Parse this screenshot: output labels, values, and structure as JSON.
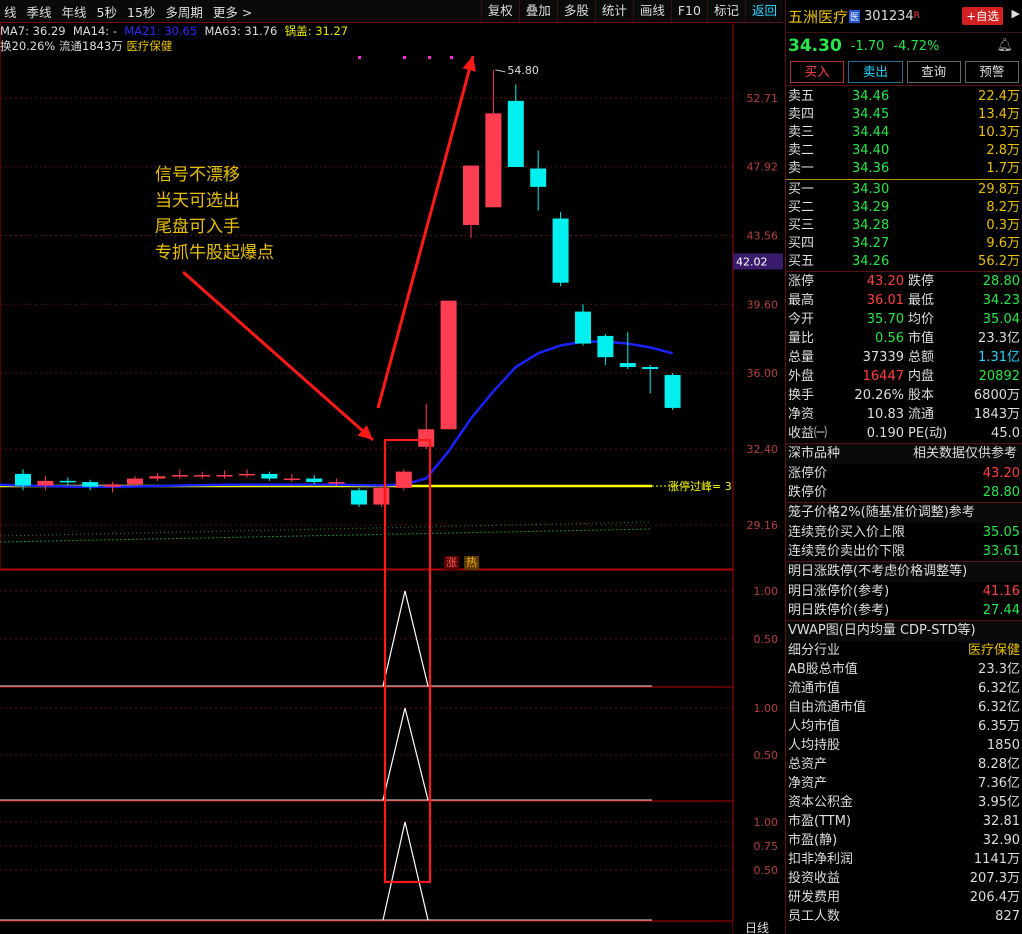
{
  "toolbar": {
    "left": [
      "线",
      "季线",
      "年线",
      "5秒",
      "15秒",
      "多周期",
      "更多 >"
    ],
    "right": [
      "复权",
      "叠加",
      "多股",
      "统计",
      "画线",
      "F10",
      "标记",
      "返回"
    ],
    "active": "返回"
  },
  "ma": {
    "ma7": "MA7: 36.29",
    "ma14": "MA14: -",
    "ma21": "MA21: 30.65",
    "ma63": "MA63: 31.76",
    "gai": "锅盖: 31.27"
  },
  "info": {
    "text": "换20.26% 流通1843万",
    "industry": "医疗保健"
  },
  "price_axis": [
    "52.71",
    "47.92",
    "43.56",
    "39.60",
    "36.00",
    "32.40",
    "29.16"
  ],
  "current_price_tag": "42.02",
  "high_label": "54.80",
  "limit_line_label": "涨停过峰= 3",
  "candle_tags": {
    "up": "涨",
    "hot": "热"
  },
  "annotation": [
    "信号不漂移",
    "当天可选出",
    "尾盘可入手",
    "专抓牛股起爆点"
  ],
  "sub_axes": [
    [
      "1.00",
      "0.50"
    ],
    [
      "1.00",
      "0.50"
    ],
    [
      "1.00",
      "0.75",
      "0.50"
    ]
  ],
  "bottom_tag": "日线",
  "stock": {
    "name": "五洲医疗",
    "code": "301234",
    "r": "R",
    "add_btn": "+自选",
    "arrow": "▶",
    "badge": "医"
  },
  "quote": {
    "price": "34.30",
    "change": "-1.70",
    "pct": "-4.72%"
  },
  "actions": [
    "买入",
    "卖出",
    "查询",
    "预警"
  ],
  "asks": [
    {
      "label": "卖五",
      "price": "34.46",
      "vol": "22.4万"
    },
    {
      "label": "卖四",
      "price": "34.45",
      "vol": "13.4万"
    },
    {
      "label": "卖三",
      "price": "34.44",
      "vol": "10.3万"
    },
    {
      "label": "卖二",
      "price": "34.40",
      "vol": "2.8万"
    },
    {
      "label": "卖一",
      "price": "34.36",
      "vol": "1.7万"
    }
  ],
  "bids": [
    {
      "label": "买一",
      "price": "34.30",
      "vol": "29.8万"
    },
    {
      "label": "买二",
      "price": "34.29",
      "vol": "8.2万"
    },
    {
      "label": "买三",
      "price": "34.28",
      "vol": "0.3万"
    },
    {
      "label": "买四",
      "price": "34.27",
      "vol": "9.6万"
    },
    {
      "label": "买五",
      "price": "34.26",
      "vol": "56.2万"
    }
  ],
  "stats": [
    {
      "l1": "涨停",
      "v1": "43.20",
      "c1": "red",
      "l2": "跌停",
      "v2": "28.80",
      "c2": "grn"
    },
    {
      "l1": "最高",
      "v1": "36.01",
      "c1": "red",
      "l2": "最低",
      "v2": "34.23",
      "c2": "grn"
    },
    {
      "l1": "今开",
      "v1": "35.70",
      "c1": "grn",
      "l2": "均价",
      "v2": "35.04",
      "c2": "grn"
    },
    {
      "l1": "量比",
      "v1": "0.56",
      "c1": "grn",
      "l2": "市值",
      "v2": "23.3亿",
      "c2": "wht"
    },
    {
      "l1": "总量",
      "v1": "37339",
      "c1": "wht",
      "l2": "总额",
      "v2": "1.31亿",
      "c2": "cyn"
    },
    {
      "l1": "外盘",
      "v1": "16447",
      "c1": "red",
      "l2": "内盘",
      "v2": "20892",
      "c2": "grn"
    },
    {
      "l1": "换手",
      "v1": "20.26%",
      "c1": "wht",
      "l2": "股本",
      "v2": "6800万",
      "c2": "wht"
    },
    {
      "l1": "净资",
      "v1": "10.83",
      "c1": "wht",
      "l2": "流通",
      "v2": "1843万",
      "c2": "wht"
    },
    {
      "l1": "收益㈠",
      "v1": "0.190",
      "c1": "wht",
      "l2": "PE(动)",
      "v2": "45.0",
      "c2": "wht"
    }
  ],
  "sec1": {
    "title": "深市品种",
    "right": "相关数据仅供参考"
  },
  "limits": [
    {
      "k": "涨停价",
      "v": "43.20",
      "c": "red"
    },
    {
      "k": "跌停价",
      "v": "28.80",
      "c": "grn"
    }
  ],
  "cage": {
    "title": "笼子价格2%(随基准价调整)参考"
  },
  "cage_rows": [
    {
      "k": "连续竞价买入价上限",
      "v": "35.05",
      "c": "grn"
    },
    {
      "k": "连续竞价卖出价下限",
      "v": "33.61",
      "c": "grn"
    }
  ],
  "tomorrow": {
    "title": "明日涨跌停(不考虑价格调整等)"
  },
  "tomorrow_rows": [
    {
      "k": "明日涨停价(参考)",
      "v": "41.16",
      "c": "red"
    },
    {
      "k": "明日跌停价(参考)",
      "v": "27.44",
      "c": "grn"
    }
  ],
  "vwap": {
    "title": "VWAP图(日内均量 CDP-STD等)"
  },
  "fund": [
    {
      "k": "细分行业",
      "v": "医疗保健",
      "c": "yel"
    },
    {
      "k": "AB股总市值",
      "v": "23.3亿",
      "c": "wht"
    },
    {
      "k": "流通市值",
      "v": "6.32亿",
      "c": "wht"
    },
    {
      "k": "自由流通市值",
      "v": "6.32亿",
      "c": "wht"
    },
    {
      "k": "人均市值",
      "v": "6.35万",
      "c": "wht"
    },
    {
      "k": "人均持股",
      "v": "1850",
      "c": "wht"
    },
    {
      "k": "总资产",
      "v": "8.28亿",
      "c": "wht"
    },
    {
      "k": "净资产",
      "v": "7.36亿",
      "c": "wht"
    },
    {
      "k": "资本公积金",
      "v": "3.95亿",
      "c": "wht"
    },
    {
      "k": "市盈(TTM)",
      "v": "32.81",
      "c": "wht"
    },
    {
      "k": "市盈(静)",
      "v": "32.90",
      "c": "wht"
    },
    {
      "k": "扣非净利润",
      "v": "1141万",
      "c": "wht"
    },
    {
      "k": "投资收益",
      "v": "207.3万",
      "c": "wht"
    },
    {
      "k": "研发费用",
      "v": "206.4万",
      "c": "wht"
    },
    {
      "k": "员工人数",
      "v": "827",
      "c": "wht"
    }
  ],
  "candles": [
    {
      "o": 31.3,
      "c": 30.8,
      "h": 31.5,
      "l": 30.6
    },
    {
      "o": 30.8,
      "c": 31.0,
      "h": 31.2,
      "l": 30.6
    },
    {
      "o": 31.0,
      "c": 30.95,
      "h": 31.15,
      "l": 30.8
    },
    {
      "o": 30.95,
      "c": 30.75,
      "h": 31.05,
      "l": 30.6
    },
    {
      "o": 30.75,
      "c": 30.85,
      "h": 30.95,
      "l": 30.5
    },
    {
      "o": 30.85,
      "c": 31.1,
      "h": 31.2,
      "l": 30.8
    },
    {
      "o": 31.1,
      "c": 31.2,
      "h": 31.35,
      "l": 31.0
    },
    {
      "o": 31.2,
      "c": 31.25,
      "h": 31.5,
      "l": 31.1
    },
    {
      "o": 31.25,
      "c": 31.25,
      "h": 31.4,
      "l": 31.1
    },
    {
      "o": 31.25,
      "c": 31.25,
      "h": 31.45,
      "l": 31.1
    },
    {
      "o": 31.25,
      "c": 31.3,
      "h": 31.5,
      "l": 31.15
    },
    {
      "o": 31.3,
      "c": 31.1,
      "h": 31.4,
      "l": 31.0
    },
    {
      "o": 31.1,
      "c": 31.1,
      "h": 31.3,
      "l": 30.95
    },
    {
      "o": 31.1,
      "c": 30.95,
      "h": 31.25,
      "l": 30.85
    },
    {
      "o": 30.95,
      "c": 30.95,
      "h": 31.1,
      "l": 30.8
    },
    {
      "o": 30.6,
      "c": 30.0,
      "h": 30.7,
      "l": 29.9
    },
    {
      "o": 30.0,
      "c": 30.7,
      "h": 30.8,
      "l": 29.9
    },
    {
      "o": 30.7,
      "c": 31.4,
      "h": 31.5,
      "l": 30.6
    },
    {
      "o": 32.5,
      "c": 33.3,
      "h": 34.5,
      "l": 32.4
    },
    {
      "o": 33.3,
      "c": 39.8,
      "h": 39.8,
      "l": 33.3
    },
    {
      "o": 44.2,
      "c": 48.0,
      "h": 48.0,
      "l": 43.4
    },
    {
      "o": 45.3,
      "c": 51.6,
      "h": 54.8,
      "l": 45.3
    },
    {
      "o": 52.5,
      "c": 47.9,
      "h": 53.7,
      "l": 47.9
    },
    {
      "o": 47.8,
      "c": 46.6,
      "h": 49.0,
      "l": 45.1
    },
    {
      "o": 44.6,
      "c": 40.8,
      "h": 45.0,
      "l": 40.6
    },
    {
      "o": 39.2,
      "c": 37.5,
      "h": 39.6,
      "l": 37.4
    },
    {
      "o": 37.9,
      "c": 36.8,
      "h": 38.0,
      "l": 36.4
    },
    {
      "o": 36.5,
      "c": 36.3,
      "h": 38.1,
      "l": 36.2
    },
    {
      "o": 36.3,
      "c": 36.2,
      "h": 36.4,
      "l": 35.0
    },
    {
      "o": 35.9,
      "c": 34.3,
      "h": 36.0,
      "l": 34.2
    }
  ],
  "ma21_series": [
    30.8,
    30.78,
    30.76,
    30.75,
    30.75,
    30.76,
    30.78,
    30.8,
    30.82,
    30.83,
    30.84,
    30.84,
    30.84,
    30.84,
    30.84,
    30.82,
    30.8,
    30.85,
    31.1,
    32.3,
    33.8,
    35.1,
    36.3,
    37.0,
    37.4,
    37.6,
    37.6,
    37.5,
    37.3,
    37.0
  ],
  "colors": {
    "up": "#ff3d50",
    "down": "#00f0f0",
    "ma": "#1a22ff",
    "limit": "#ffff00",
    "frame": "#b00000",
    "annot": "#e8c000"
  }
}
